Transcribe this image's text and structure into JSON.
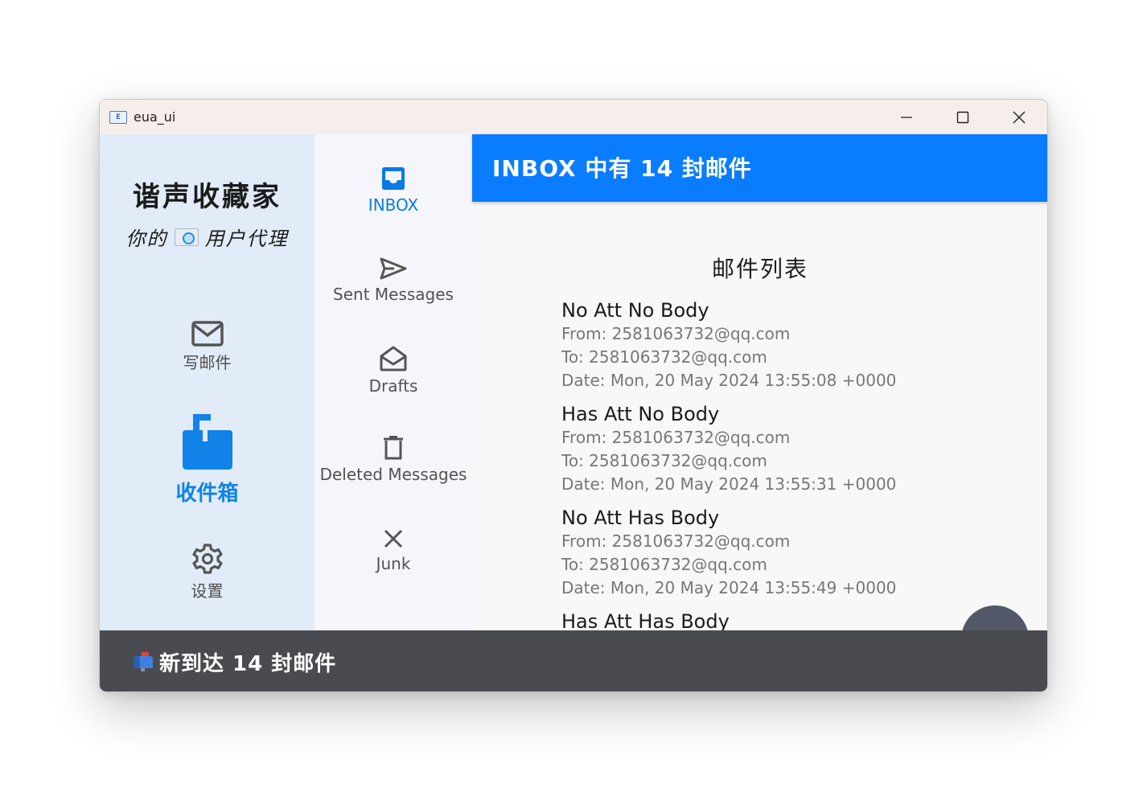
{
  "window": {
    "title": "eua_ui",
    "icon": "app-mail-icon",
    "icon_text": "E"
  },
  "brand": {
    "title": "谐声收藏家",
    "subtitle_before": "你的",
    "subtitle_after": "用户代理"
  },
  "rail": {
    "items": [
      {
        "label": "写邮件",
        "icon": "envelope-icon",
        "active": false
      },
      {
        "label": "收件箱",
        "icon": "mailbox-icon",
        "active": true
      },
      {
        "label": "设置",
        "icon": "gear-icon",
        "active": false
      }
    ]
  },
  "folders": [
    {
      "label": "INBOX",
      "icon": "inbox-tray-icon",
      "active": true
    },
    {
      "label": "Sent Messages",
      "icon": "paper-plane-icon",
      "active": false
    },
    {
      "label": "Drafts",
      "icon": "open-envelope-icon",
      "active": false
    },
    {
      "label": "Deleted Messages",
      "icon": "trash-icon",
      "active": false
    },
    {
      "label": "Junk",
      "icon": "close-x-icon",
      "active": false
    }
  ],
  "header": {
    "title": "INBOX 中有 14 封邮件"
  },
  "mail_list": {
    "title": "邮件列表",
    "items": [
      {
        "subject": "No Att No Body",
        "from": "From: 2581063732@qq.com",
        "to": "To: 2581063732@qq.com",
        "date": "Date: Mon, 20 May 2024 13:55:08 +0000"
      },
      {
        "subject": "Has Att No Body",
        "from": "From: 2581063732@qq.com",
        "to": "To: 2581063732@qq.com",
        "date": "Date: Mon, 20 May 2024 13:55:31 +0000"
      },
      {
        "subject": "No Att Has Body",
        "from": "From: 2581063732@qq.com",
        "to": "To: 2581063732@qq.com",
        "date": "Date: Mon, 20 May 2024 13:55:49 +0000"
      },
      {
        "subject": "Has Att Has Body"
      }
    ]
  },
  "snackbar": {
    "text": "新到达 14 封邮件",
    "icon": "mailbox-flag-icon"
  },
  "colors": {
    "accent": "#0a7cff",
    "rail_bg": "#e1ecf8",
    "folders_bg": "#f5f6fb",
    "snackbar_bg": "#4a4b51",
    "fab_bg": "#535868"
  }
}
